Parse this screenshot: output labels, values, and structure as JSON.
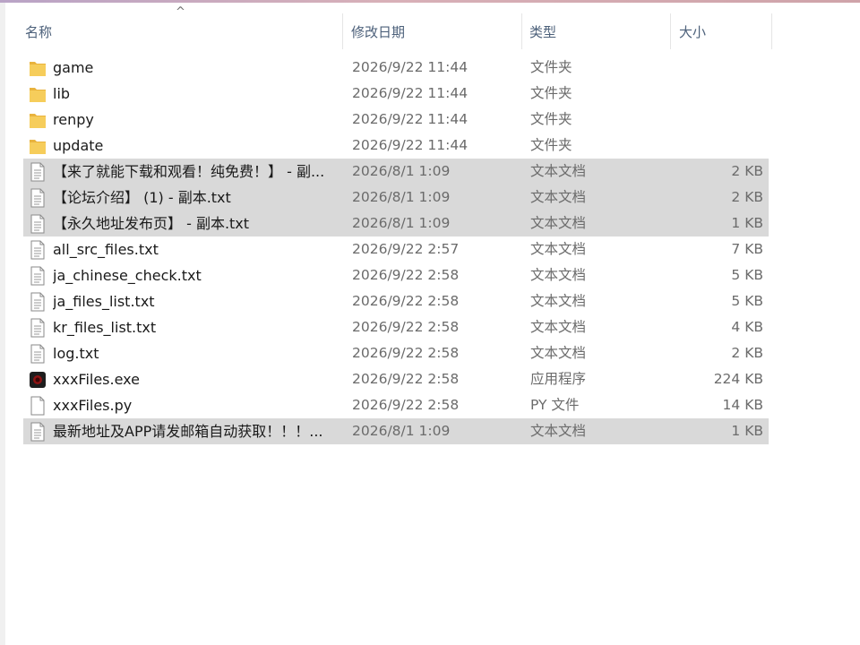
{
  "header": {
    "columns": [
      "名称",
      "修改日期",
      "类型",
      "大小"
    ],
    "sort_indicator": "^"
  },
  "files": [
    {
      "name": "game",
      "date": "2026/9/22 11:44",
      "type": "文件夹",
      "size": "",
      "icon": "folder-icon",
      "selected": false
    },
    {
      "name": "lib",
      "date": "2026/9/22 11:44",
      "type": "文件夹",
      "size": "",
      "icon": "folder-icon",
      "selected": false
    },
    {
      "name": "renpy",
      "date": "2026/9/22 11:44",
      "type": "文件夹",
      "size": "",
      "icon": "folder-icon",
      "selected": false
    },
    {
      "name": "update",
      "date": "2026/9/22 11:44",
      "type": "文件夹",
      "size": "",
      "icon": "folder-icon",
      "selected": false
    },
    {
      "name": "【来了就能下载和观看！纯免费！】 - 副...",
      "date": "2026/8/1 1:09",
      "type": "文本文档",
      "size": "2 KB",
      "icon": "text-file-icon",
      "selected": true
    },
    {
      "name": "【论坛介绍】 (1) - 副本.txt",
      "date": "2026/8/1 1:09",
      "type": "文本文档",
      "size": "2 KB",
      "icon": "text-file-icon",
      "selected": true
    },
    {
      "name": "【永久地址发布页】 - 副本.txt",
      "date": "2026/8/1 1:09",
      "type": "文本文档",
      "size": "1 KB",
      "icon": "text-file-icon",
      "selected": true
    },
    {
      "name": "all_src_files.txt",
      "date": "2026/9/22 2:57",
      "type": "文本文档",
      "size": "7 KB",
      "icon": "text-file-icon",
      "selected": false
    },
    {
      "name": "ja_chinese_check.txt",
      "date": "2026/9/22 2:58",
      "type": "文本文档",
      "size": "5 KB",
      "icon": "text-file-icon",
      "selected": false
    },
    {
      "name": "ja_files_list.txt",
      "date": "2026/9/22 2:58",
      "type": "文本文档",
      "size": "5 KB",
      "icon": "text-file-icon",
      "selected": false
    },
    {
      "name": "kr_files_list.txt",
      "date": "2026/9/22 2:58",
      "type": "文本文档",
      "size": "4 KB",
      "icon": "text-file-icon",
      "selected": false
    },
    {
      "name": "log.txt",
      "date": "2026/9/22 2:58",
      "type": "文本文档",
      "size": "2 KB",
      "icon": "text-file-icon",
      "selected": false
    },
    {
      "name": "xxxFiles.exe",
      "date": "2026/9/22 2:58",
      "type": "应用程序",
      "size": "224 KB",
      "icon": "exe-icon",
      "selected": false
    },
    {
      "name": "xxxFiles.py",
      "date": "2026/9/22 2:58",
      "type": "PY 文件",
      "size": "14 KB",
      "icon": "blank-file-icon",
      "selected": false
    },
    {
      "name": "最新地址及APP请发邮箱自动获取！！！...",
      "date": "2026/8/1 1:09",
      "type": "文本文档",
      "size": "1 KB",
      "icon": "text-file-icon",
      "selected": true
    }
  ],
  "colors": {
    "selected_row": "#d9d9d9",
    "header_text": "#4c607a",
    "folder": "#f3c44f"
  }
}
